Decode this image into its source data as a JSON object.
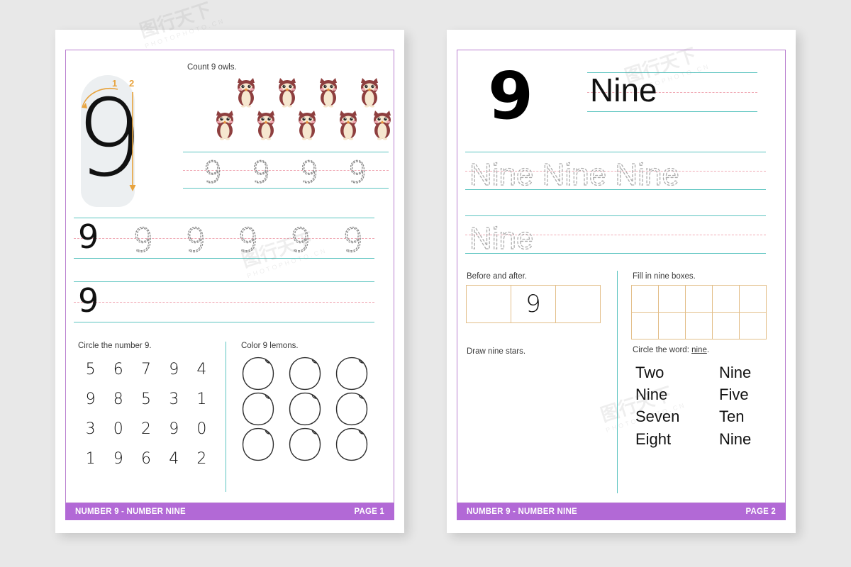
{
  "background_color": "#e8e8e8",
  "theme": {
    "accent_purple": "#b269d6",
    "border_purple": "#b97fd0",
    "rule_teal": "#5bc4c0",
    "rule_pink": "#f0aab5",
    "box_orange": "#e3bf8a",
    "arrow_orange": "#e8a33d",
    "owl_body": "#8e3f3f",
    "owl_belly": "#f6e7cf"
  },
  "pages": [
    {
      "id": "page-1",
      "footer_title": "NUMBER 9 - NUMBER NINE",
      "footer_page": "PAGE 1",
      "guide": {
        "numeral": "9",
        "stroke_labels": [
          "1",
          "2"
        ]
      },
      "count_task": {
        "label": "Count 9 owls.",
        "icon": "owl-icon",
        "count": 9,
        "row_counts": [
          4,
          5
        ]
      },
      "trace_rows": [
        {
          "name": "trace-row-small",
          "model": "9",
          "traces": [
            "9",
            "9",
            "9",
            "9"
          ]
        },
        {
          "name": "trace-row-large",
          "model": "9",
          "traces": [
            "9",
            "9",
            "9",
            "9",
            "9"
          ]
        },
        {
          "name": "trace-row-blank",
          "model": "9",
          "traces": []
        }
      ],
      "circle_task": {
        "label": "Circle the number 9.",
        "target": "9",
        "rows": [
          [
            "5",
            "6",
            "7",
            "9",
            "4"
          ],
          [
            "9",
            "8",
            "5",
            "3",
            "1"
          ],
          [
            "3",
            "0",
            "2",
            "9",
            "0"
          ],
          [
            "1",
            "9",
            "6",
            "4",
            "2"
          ]
        ]
      },
      "color_task": {
        "label": "Color 9 lemons.",
        "icon": "lemon-icon",
        "count": 9,
        "grid": [
          3,
          3
        ]
      }
    },
    {
      "id": "page-2",
      "footer_title": "NUMBER 9 - NUMBER NINE",
      "footer_page": "PAGE 2",
      "header": {
        "numeral": "9",
        "word": "Nine"
      },
      "word_trace_rows": [
        {
          "name": "word-trace-row-1",
          "text": "Nine Nine Nine"
        },
        {
          "name": "word-trace-row-2",
          "text": "Nine"
        }
      ],
      "before_after": {
        "label": "Before and after.",
        "cells": [
          "",
          "9",
          ""
        ]
      },
      "fill_boxes": {
        "label": "Fill in nine boxes.",
        "columns": 5,
        "rows": 2
      },
      "draw_task": {
        "label": "Draw nine stars."
      },
      "circle_word": {
        "label_prefix": "Circle the word: ",
        "label_target": "nine",
        "label_suffix": ".",
        "words_left": [
          "Two",
          "Nine",
          "Seven",
          "Eight"
        ],
        "words_right": [
          "Nine",
          "Five",
          "Ten",
          "Nine"
        ]
      }
    }
  ],
  "watermark": {
    "text": "图行天下",
    "sub": "PHOTOPHOTO.CN"
  }
}
